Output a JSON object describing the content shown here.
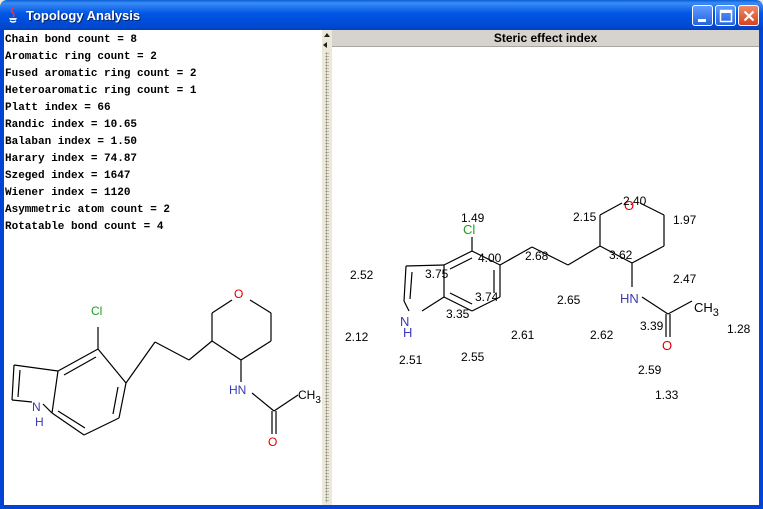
{
  "window": {
    "title": "Topology Analysis"
  },
  "metrics": [
    "Chain bond count = 8",
    "Aromatic ring count = 2",
    "Fused aromatic ring count = 2",
    "Heteroaromatic ring count = 1",
    "Platt index = 66",
    "Randic index = 10.65",
    "Balaban index = 1.50",
    "Harary index = 74.87",
    "Szeged index = 1647",
    "Wiener index = 1120",
    "Asymmetric atom count = 2",
    "Rotatable bond count = 4"
  ],
  "left_molecule": {
    "atoms": {
      "cl": "Cl",
      "o": "O",
      "nh": "HN",
      "n": "N",
      "h": "H",
      "ch3": "CH",
      "ch3_sub": "3",
      "o2": "O"
    }
  },
  "right_panel": {
    "header": "Steric effect index",
    "atoms": {
      "cl": "Cl",
      "o": "O",
      "nh": "HN",
      "n": "N",
      "h": "H",
      "ch3": "CH",
      "ch3_sub": "3",
      "o2": "O"
    },
    "values": {
      "cl": "1.49",
      "c_cl": "4.00",
      "c_top": "3.75",
      "c_chain": "3.74",
      "c_fused": "3.35",
      "ind_c3": "2.52",
      "ind_c2": "2.12",
      "nh": "2.51",
      "c_bot": "2.55",
      "c_right": "2.61",
      "ch2_a": "2.68",
      "ch2_b": "2.65",
      "ox_c5": "3.62",
      "ox_ctl": "2.15",
      "o": "2.40",
      "ox_ctr": "1.97",
      "ox_cr": "2.47",
      "ox_c4": "3.39",
      "amide_n": "2.62",
      "c_co": "2.59",
      "o_co": "1.33",
      "ch3": "1.28"
    }
  }
}
